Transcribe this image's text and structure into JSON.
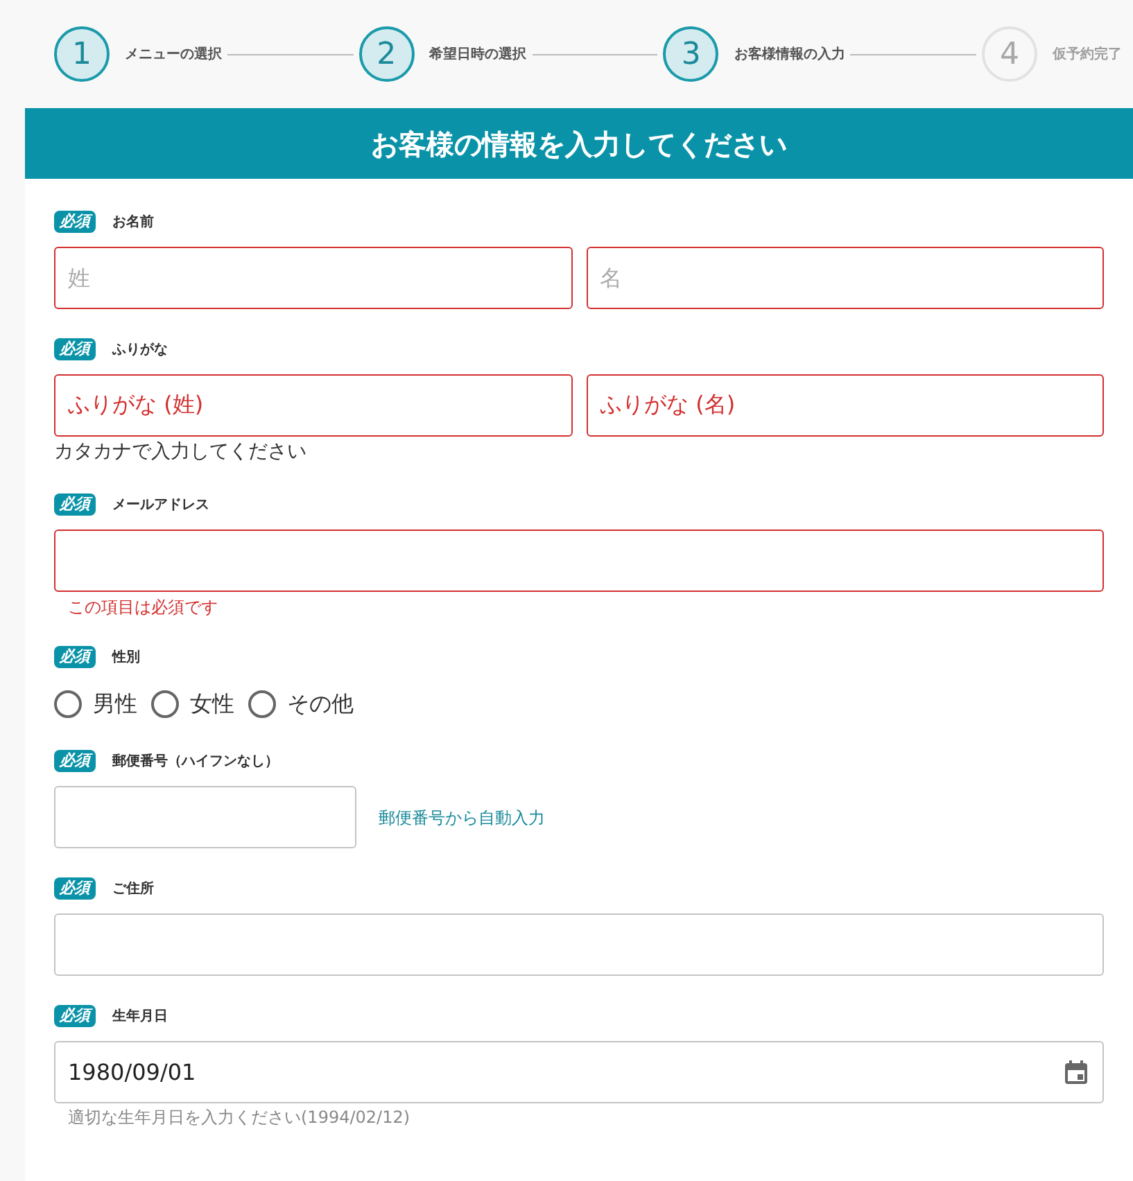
{
  "steps": [
    {
      "number": "1",
      "label": "メニューの選択",
      "active": true
    },
    {
      "number": "2",
      "label": "希望日時の選択",
      "active": true
    },
    {
      "number": "3",
      "label": "お客様情報の入力",
      "active": true
    },
    {
      "number": "4",
      "label": "仮予約完了",
      "active": false
    }
  ],
  "form": {
    "title": "お客様の情報を入力してください",
    "fields": [
      {
        "kind": "pair",
        "badge": "必須",
        "label": "お名前",
        "inputs": [
          {
            "placeholder": "姓",
            "error": true
          },
          {
            "placeholder": "名",
            "error": true
          }
        ]
      },
      {
        "kind": "pair",
        "badge": "必須",
        "label": "ふりがな",
        "inputs": [
          {
            "value": "ふりがな (姓)",
            "error": true
          },
          {
            "value": "ふりがな (名)",
            "error": true
          }
        ],
        "help": "カタカナで入力してください"
      },
      {
        "kind": "text",
        "badge": "必須",
        "label": "メールアドレス",
        "error": true,
        "message": "この項目は必須です"
      },
      {
        "kind": "radio",
        "badge": "必須",
        "label": "性別",
        "options": [
          {
            "label": "男性",
            "selected": false
          },
          {
            "label": "女性",
            "selected": false
          },
          {
            "label": "その他",
            "selected": false
          }
        ]
      },
      {
        "kind": "postal",
        "badge": "必須",
        "label": "郵便番号（ハイフンなし）",
        "link": "郵便番号から自動入力"
      },
      {
        "kind": "text",
        "badge": "必須",
        "label": "ご住所",
        "error": false
      },
      {
        "kind": "date",
        "badge": "必須",
        "label": "生年月日",
        "value": "1980/09/01",
        "hint": "適切な生年月日を入力ください(1994/02/12)"
      }
    ]
  }
}
